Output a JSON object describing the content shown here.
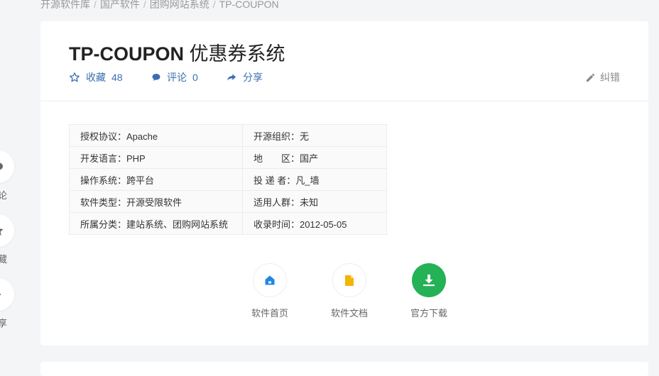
{
  "breadcrumb": {
    "items": [
      "开源软件库",
      "国产软件",
      "团购网站系统",
      "TP-COUPON"
    ],
    "separator": "/"
  },
  "header": {
    "title_en": "TP-COUPON",
    "title_cn": "优惠券系统",
    "favorite_label": "收藏",
    "favorite_count": "48",
    "comment_label": "评论",
    "comment_count": "0",
    "share_label": "分享",
    "report_label": "纠错"
  },
  "info_table": {
    "rows": [
      [
        "授权协议：Apache",
        "开源组织：无"
      ],
      [
        "开发语言：PHP",
        "地　　区：国产"
      ],
      [
        "操作系统：跨平台",
        "投 递 者：凡_墙"
      ],
      [
        "软件类型：开源受限软件",
        "适用人群：未知"
      ],
      [
        "所属分类：建站系统、团购网站系统",
        "收录时间：2012-05-05"
      ]
    ]
  },
  "links": {
    "home_label": "软件首页",
    "docs_label": "软件文档",
    "download_label": "官方下载"
  },
  "side": {
    "comment_label": "评论",
    "favorite_label": "收藏",
    "share_label": "分享"
  },
  "colors": {
    "accent": "#3a6fb0",
    "download_green": "#25b155",
    "home_icon_blue": "#1e88e5",
    "docs_icon_yellow": "#f5b400"
  }
}
